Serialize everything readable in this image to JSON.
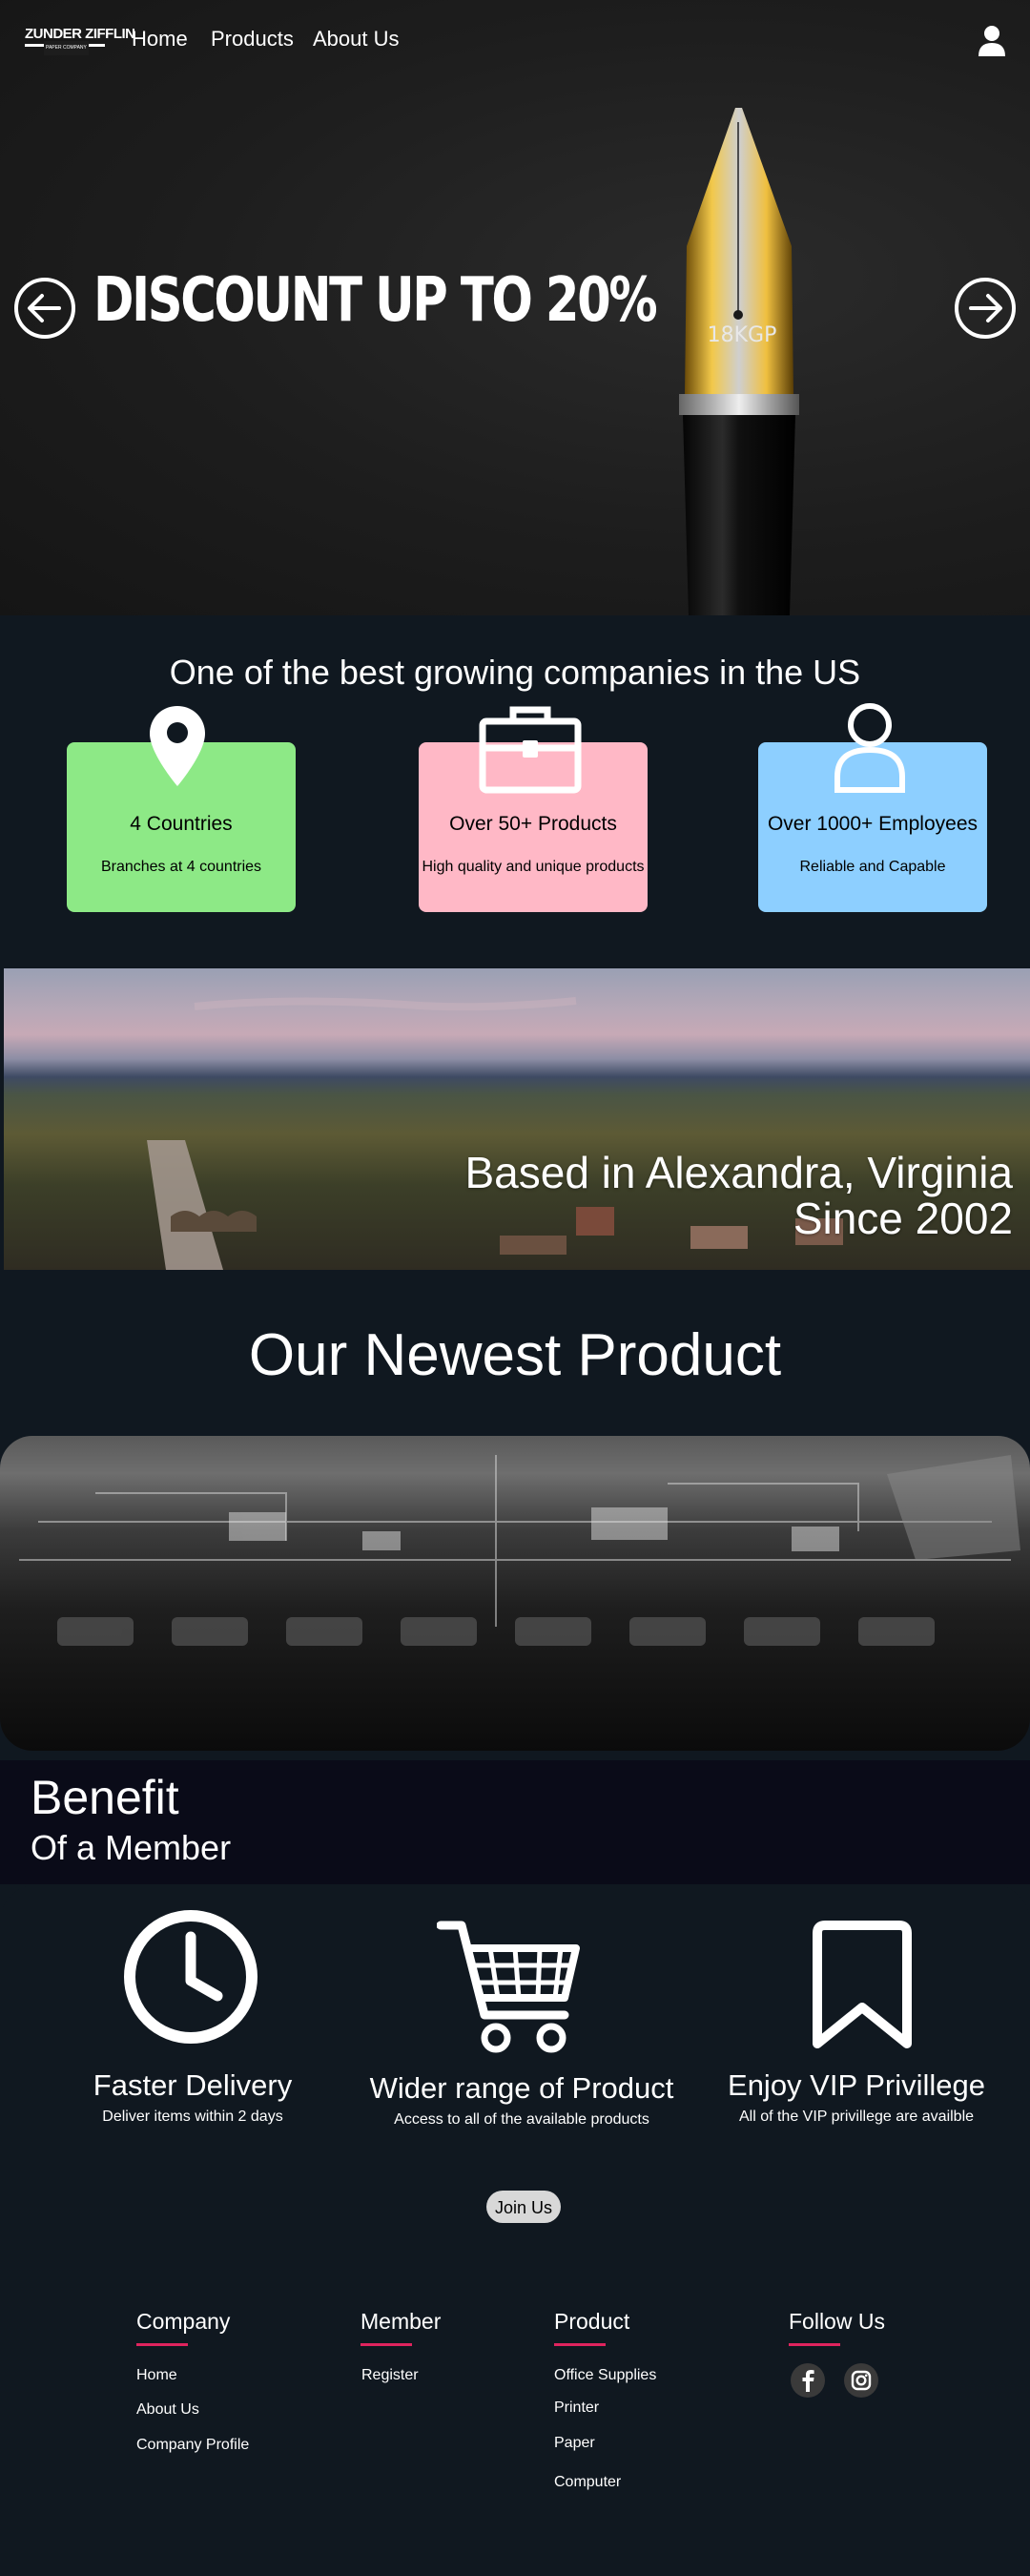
{
  "header": {
    "logo_text": "ZUNDER ZIFFLIN",
    "logo_sub": "PAPER COMPANY",
    "nav": [
      "Home",
      "Products",
      "About Us"
    ],
    "user_icon": "user-icon"
  },
  "hero": {
    "title": "DISCOUNT UP TO 20%",
    "pen_engraving": "18KGP",
    "left_arrow_icon": "arrow-left-circle-icon",
    "right_arrow_icon": "arrow-right-circle-icon"
  },
  "stats": {
    "title": "One of the best growing companies in the US",
    "cards": [
      {
        "icon": "map-pin-icon",
        "title": "4 Countries",
        "subtitle": "Branches at 4 countries",
        "color": "#8de986"
      },
      {
        "icon": "briefcase-icon",
        "title": "Over 50+ Products",
        "subtitle": "High quality and unique products",
        "color": "#ffb8c6"
      },
      {
        "icon": "person-icon",
        "title": "Over 1000+ Employees",
        "subtitle": "Reliable and Capable",
        "color": "#8dcfff"
      }
    ]
  },
  "city": {
    "line1": "Based in Alexandra, Virginia",
    "line2": "Since 2002"
  },
  "newest": {
    "title": "Our Newest Product"
  },
  "benefit": {
    "heading": "Benefit",
    "subheading": "Of a Member",
    "items": [
      {
        "icon": "clock-icon",
        "title": "Faster Delivery",
        "subtitle": "Deliver items within 2 days"
      },
      {
        "icon": "shopping-cart-icon",
        "title": "Wider range of Product",
        "subtitle": "Access to all of the available products"
      },
      {
        "icon": "bookmark-icon",
        "title": "Enjoy VIP Privillege",
        "subtitle": "All of the VIP privillege are availble"
      }
    ],
    "join_label": "Join Us"
  },
  "footer": {
    "company": {
      "heading": "Company",
      "links": [
        "Home",
        "About Us",
        "Company Profile"
      ]
    },
    "member": {
      "heading": "Member",
      "links": [
        "Register"
      ]
    },
    "product": {
      "heading": "Product",
      "links": [
        "Office Supplies",
        "Printer",
        "Paper",
        "Computer"
      ]
    },
    "follow": {
      "heading": "Follow Us",
      "icons": [
        "facebook-icon",
        "instagram-icon"
      ]
    }
  },
  "colors": {
    "background": "#101820",
    "accent_underline": "#e0245e",
    "join_button": "#d8d8d8"
  }
}
